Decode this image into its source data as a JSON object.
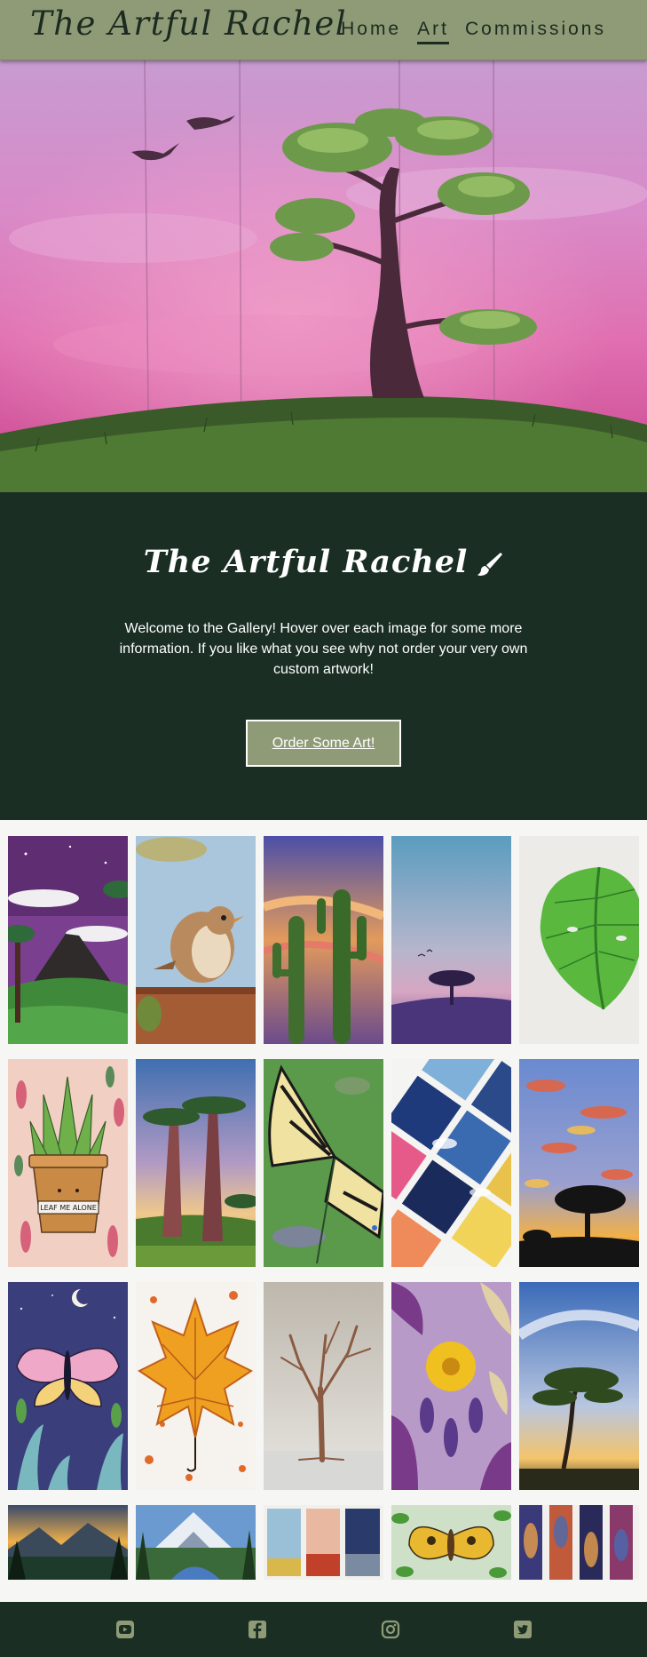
{
  "header": {
    "brand": "The Artful Rachel",
    "nav": [
      {
        "label": "Home",
        "active": false
      },
      {
        "label": "Art",
        "active": true
      },
      {
        "label": "Commissions",
        "active": false
      }
    ]
  },
  "hero": {
    "image": "pink-sunset-tree-painting"
  },
  "intro": {
    "title": "The Artful Rachel",
    "title_icon": "paintbrush-icon",
    "text": "Welcome to the Gallery! Hover over each image for some more information. If you like what you see why not order your very own custom artwork!",
    "button_label": "Order Some Art!"
  },
  "gallery": {
    "rows": [
      [
        "volcano-night-painting",
        "wren-bird-painting",
        "cactus-sunset-painting",
        "purple-horizon-tree-painting",
        "monstera-leaf-painting"
      ],
      [
        "leaf-me-alone-cactus-painting",
        "baobab-trees-painting",
        "swallowtail-butterfly-painting",
        "watercolor-sky-diamonds-painting",
        "acacia-sunset-painting"
      ],
      [
        "moon-moth-painting",
        "autumn-maple-leaf-painting",
        "bare-winter-tree-painting",
        "yellow-flower-leaves-painting",
        "windswept-tree-painting"
      ],
      [
        "mountain-lake-sunset-painting",
        "snowy-mountain-river-painting",
        "triptych-landscape-painting",
        "golden-moth-painting",
        "galaxy-panels-painting"
      ]
    ],
    "pot_text": "LEAF ME ALONE"
  },
  "footer": {
    "icons": [
      "youtube-icon",
      "facebook-icon",
      "instagram-icon",
      "twitter-icon"
    ]
  },
  "colors": {
    "header_bg": "#8f9b76",
    "dark_green": "#1a2e24",
    "button_bg": "#8f9b76",
    "footer_icon": "#8f9b76"
  }
}
